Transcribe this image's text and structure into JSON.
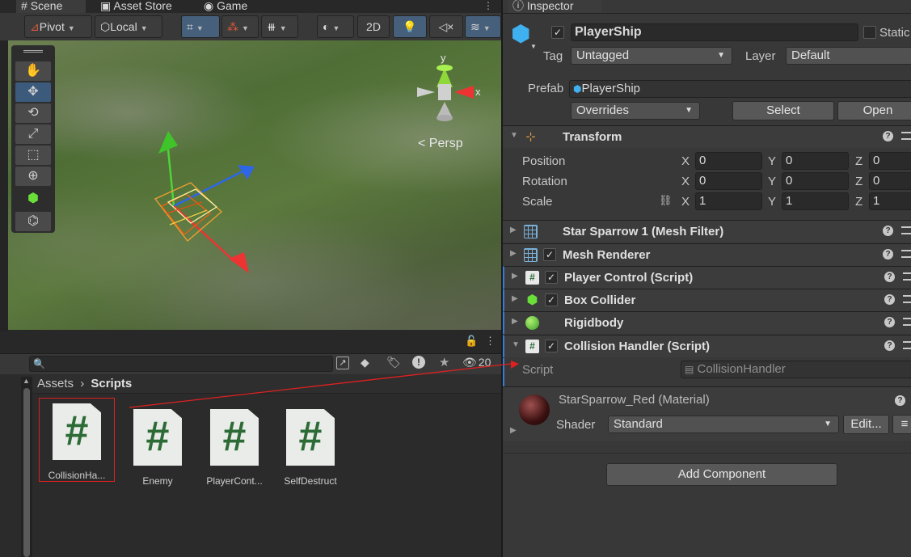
{
  "tabs": {
    "scene": "Scene",
    "asset_store": "Asset Store",
    "game": "Game",
    "inspector": "Inspector"
  },
  "scene_toolbar": {
    "pivot": "Pivot",
    "local": "Local",
    "two_d": "2D"
  },
  "scene_view": {
    "persp_label": "< Persp",
    "axis_y": "y",
    "axis_x": "x"
  },
  "inspector": {
    "object_name": "PlayerShip",
    "static_label": "Static",
    "tag_label": "Tag",
    "tag_value": "Untagged",
    "layer_label": "Layer",
    "layer_value": "Default",
    "prefab_label": "Prefab",
    "prefab_value": "PlayerShip",
    "overrides_label": "Overrides",
    "select_label": "Select",
    "open_label": "Open",
    "transform": {
      "title": "Transform",
      "rows": [
        {
          "label": "Position",
          "x": "0",
          "y": "0",
          "z": "0"
        },
        {
          "label": "Rotation",
          "x": "0",
          "y": "0",
          "z": "0"
        },
        {
          "label": "Scale",
          "x": "1",
          "y": "1",
          "z": "1"
        }
      ],
      "axis_x": "X",
      "axis_y": "Y",
      "axis_z": "Z"
    },
    "components": [
      {
        "title": "Star Sparrow 1 (Mesh Filter)"
      },
      {
        "title": "Mesh Renderer"
      },
      {
        "title": "Player Control (Script)"
      },
      {
        "title": "Box Collider"
      },
      {
        "title": "Rigidbody"
      },
      {
        "title": "Collision Handler (Script)"
      }
    ],
    "script_label": "Script",
    "script_value": "CollisionHandler",
    "material_name": "StarSparrow_Red (Material)",
    "shader_label": "Shader",
    "shader_value": "Standard",
    "edit_label": "Edit...",
    "add_component_label": "Add Component"
  },
  "project": {
    "hidden_count": "20",
    "breadcrumb_root": "Assets",
    "breadcrumb_current": "Scripts",
    "assets": [
      {
        "name": "CollisionHa..."
      },
      {
        "name": "Enemy"
      },
      {
        "name": "PlayerCont..."
      },
      {
        "name": "SelfDestruct"
      }
    ]
  },
  "colors": {
    "accent_blue": "#46607c",
    "highlight_red": "#e02020",
    "script_green": "#2d6b36"
  }
}
